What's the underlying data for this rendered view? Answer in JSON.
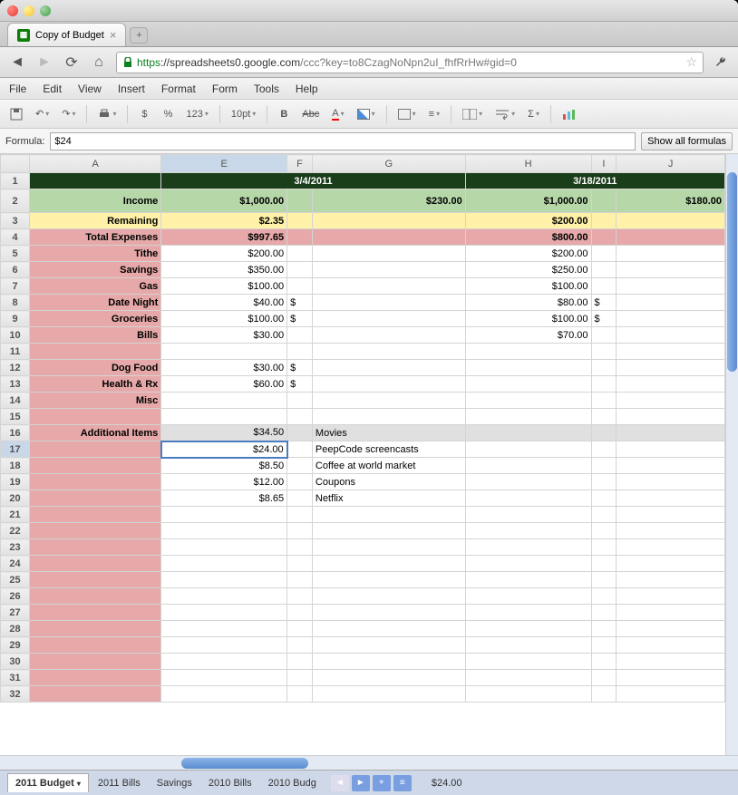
{
  "window": {
    "tab_title": "Copy of Budget"
  },
  "url": {
    "protocol": "https",
    "host_path": "://spreadsheets0.google.com",
    "rest": "/ccc?key=to8CzagNoNpn2uI_fhfRrHw#gid=0"
  },
  "menu": {
    "file": "File",
    "edit": "Edit",
    "view": "View",
    "insert": "Insert",
    "format": "Format",
    "form": "Form",
    "tools": "Tools",
    "help": "Help"
  },
  "toolbar": {
    "fontsize": "10pt",
    "numfmt": "123",
    "currency": "$",
    "percent": "%",
    "bold": "B",
    "strike": "Abc",
    "underlineA": "A",
    "sigma": "Σ"
  },
  "formula": {
    "label": "Formula:",
    "value": "$24",
    "show_all": "Show all formulas"
  },
  "columns": [
    "",
    "A",
    "E",
    "F",
    "G",
    "H",
    "I",
    "J"
  ],
  "date1": "3/4/2011",
  "date2": "3/18/2011",
  "rows": {
    "income_label": "Income",
    "income_e": "$1,000.00",
    "income_g": "$230.00",
    "income_h": "$1,000.00",
    "income_j": "$180.00",
    "remaining_label": "Remaining",
    "remaining_e": "$2.35",
    "remaining_h": "$200.00",
    "total_label": "Total Expenses",
    "total_e": "$997.65",
    "total_h": "$800.00",
    "tithe": "Tithe",
    "tithe_e": "$200.00",
    "tithe_h": "$200.00",
    "savings": "Savings",
    "savings_e": "$350.00",
    "savings_h": "$250.00",
    "gas": "Gas",
    "gas_e": "$100.00",
    "gas_h": "$100.00",
    "date_night": "Date Night",
    "dn_e": "$40.00",
    "dn_f": "$",
    "dn_h": "$80.00",
    "dn_i": "$",
    "groceries": "Groceries",
    "gr_e": "$100.00",
    "gr_f": "$",
    "gr_h": "$100.00",
    "gr_i": "$",
    "bills": "Bills",
    "bills_e": "$30.00",
    "bills_h": "$70.00",
    "dogfood": "Dog Food",
    "df_e": "$30.00",
    "df_f": "$",
    "health": "Health & Rx",
    "hr_e": "$60.00",
    "hr_f": "$",
    "misc": "Misc",
    "addl": "Additional Items",
    "a16_e": "$34.50",
    "a16_g": "Movies",
    "a17_e": "$24.00",
    "a17_g": "PeepCode screencasts",
    "a18_e": "$8.50",
    "a18_g": "Coffee at world market",
    "a19_e": "$12.00",
    "a19_g": "Coupons",
    "a20_e": "$8.65",
    "a20_g": "Netflix"
  },
  "rownums": [
    "1",
    "2",
    "3",
    "4",
    "5",
    "6",
    "7",
    "8",
    "9",
    "10",
    "11",
    "12",
    "13",
    "14",
    "15",
    "16",
    "17",
    "18",
    "19",
    "20",
    "21",
    "22",
    "23",
    "24",
    "25",
    "26",
    "27",
    "28",
    "29",
    "30",
    "31",
    "32"
  ],
  "sheets": {
    "s1": "2011 Budget",
    "s2": "2011 Bills",
    "s3": "Savings",
    "s4": "2010 Bills",
    "s5": "2010 Budg"
  },
  "status": "$24.00"
}
